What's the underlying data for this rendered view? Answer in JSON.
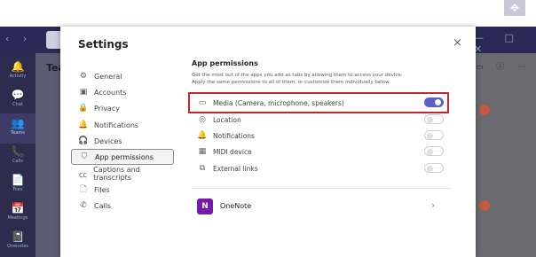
{
  "top_right_icon": "expand-arrows-icon",
  "teams_rail": [
    {
      "label": "Activity",
      "icon": "bell-icon",
      "glyph": "🔔"
    },
    {
      "label": "Chat",
      "icon": "chat-icon",
      "glyph": "💬"
    },
    {
      "label": "Teams",
      "icon": "teams-icon",
      "glyph": "👥"
    },
    {
      "label": "Calls",
      "icon": "phone-icon",
      "glyph": "📞"
    },
    {
      "label": "Files",
      "icon": "file-icon",
      "glyph": "📄"
    },
    {
      "label": "Meetings",
      "icon": "calendar-icon",
      "glyph": "📅"
    },
    {
      "label": "Onenotes",
      "icon": "notebook-icon",
      "glyph": "📓"
    }
  ],
  "teams_panel_title": "Tea",
  "settings": {
    "title": "Settings",
    "close_label": "×",
    "nav": [
      {
        "label": "General",
        "icon": "gear-icon",
        "glyph": "⚙"
      },
      {
        "label": "Accounts",
        "icon": "accounts-icon",
        "glyph": "▣"
      },
      {
        "label": "Privacy",
        "icon": "lock-icon",
        "glyph": "🔒"
      },
      {
        "label": "Notifications",
        "icon": "bell-icon",
        "glyph": "🔔"
      },
      {
        "label": "Devices",
        "icon": "headset-icon",
        "glyph": "🎧"
      },
      {
        "label": "App permissions",
        "icon": "shield-icon",
        "glyph": "⛉"
      },
      {
        "label": "Captions and transcripts",
        "icon": "cc-icon",
        "glyph": "㏄"
      },
      {
        "label": "Files",
        "icon": "file-icon",
        "glyph": "🗋"
      },
      {
        "label": "Calls",
        "icon": "phone-icon",
        "glyph": "✆"
      }
    ],
    "selected_nav": "App permissions",
    "section_title": "App permissions",
    "section_desc_1": "Get the most out of the apps you add as tabs by allowing them to access your device.",
    "section_desc_2": "Apply the same permissions to all of them, or customize them individually below.",
    "permissions": [
      {
        "label": "Media (Camera, microphone, speakers)",
        "icon": "camera-icon",
        "glyph": "▭",
        "enabled": true
      },
      {
        "label": "Location",
        "icon": "location-icon",
        "glyph": "◎",
        "enabled": false
      },
      {
        "label": "Notifications",
        "icon": "bell-icon",
        "glyph": "🔔",
        "enabled": false
      },
      {
        "label": "MIDI device",
        "icon": "keyboard-icon",
        "glyph": "▦",
        "enabled": false
      },
      {
        "label": "External links",
        "icon": "external-link-icon",
        "glyph": "⧉",
        "enabled": false
      }
    ],
    "app": {
      "name": "OneNote",
      "icon_letter": "N",
      "chevron": "›"
    }
  },
  "colors": {
    "accent": "#5b5fc7",
    "highlight": "#c4262e",
    "teams_titlebar": "#2b2a56",
    "onenote": "#7719aa"
  }
}
